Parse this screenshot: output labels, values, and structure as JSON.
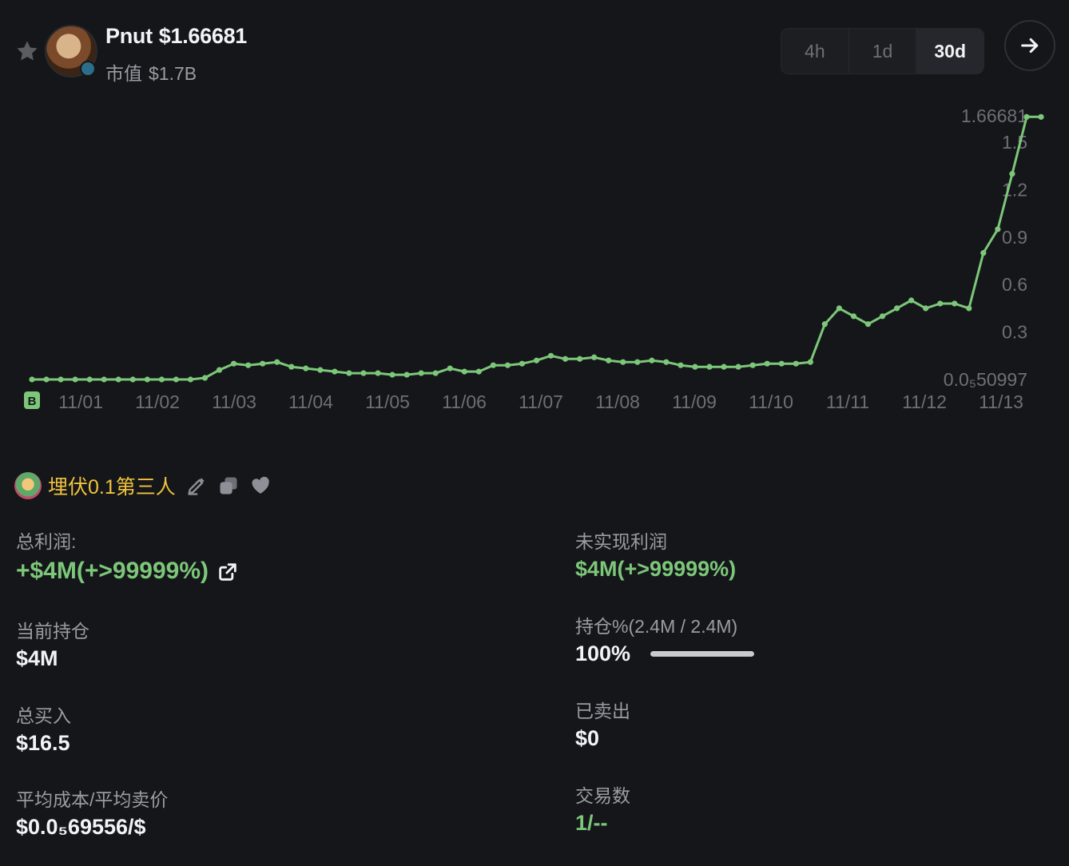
{
  "header": {
    "token_name": "Pnut",
    "price": "$1.66681",
    "market_cap_label": "市值",
    "market_cap_value": "$1.7B"
  },
  "timeframes": [
    {
      "label": "4h",
      "active": false
    },
    {
      "label": "1d",
      "active": false
    },
    {
      "label": "30d",
      "active": true
    }
  ],
  "chart_data": {
    "type": "line",
    "x": [
      "11/01",
      "11/02",
      "11/03",
      "11/04",
      "11/05",
      "11/06",
      "11/07",
      "11/08",
      "11/09",
      "11/10",
      "11/11",
      "11/12",
      "11/13"
    ],
    "y_tick_labels": [
      "1.66681",
      "1.5",
      "1.2",
      "0.9",
      "0.6",
      "0.3",
      "0.0₅50997"
    ],
    "ylim": [
      0,
      1.66681
    ],
    "start_marker": "B",
    "series_values": [
      0,
      0,
      0,
      0,
      0,
      0,
      0,
      0,
      0,
      0,
      0,
      0,
      0.01,
      0.06,
      0.1,
      0.09,
      0.1,
      0.11,
      0.08,
      0.07,
      0.06,
      0.05,
      0.04,
      0.04,
      0.04,
      0.03,
      0.03,
      0.04,
      0.04,
      0.07,
      0.05,
      0.05,
      0.09,
      0.09,
      0.1,
      0.12,
      0.15,
      0.13,
      0.13,
      0.14,
      0.12,
      0.11,
      0.11,
      0.12,
      0.11,
      0.09,
      0.08,
      0.08,
      0.08,
      0.08,
      0.09,
      0.1,
      0.1,
      0.1,
      0.11,
      0.35,
      0.45,
      0.4,
      0.35,
      0.4,
      0.45,
      0.5,
      0.45,
      0.48,
      0.48,
      0.45,
      0.8,
      0.95,
      1.3,
      1.66,
      1.66
    ],
    "color": "#7cc779"
  },
  "profile": {
    "name": "埋伏0.1第三人"
  },
  "stats": {
    "total_pnl_label": "总利润:",
    "total_pnl_value": "+$4M(+>99999%)",
    "unrealized_label": "未实现利润",
    "unrealized_value": "$4M(+>99999%)",
    "holding_label": "当前持仓",
    "holding_value": "$4M",
    "holding_pct_label": "持仓%(2.4M / 2.4M)",
    "holding_pct_value": "100%",
    "holding_pct_fraction": 1.0,
    "total_buy_label": "总买入",
    "total_buy_value": "$16.5",
    "sold_label": "已卖出",
    "sold_value": "$0",
    "avg_label": "平均成本/平均卖价",
    "avg_value": "$0.0₅69556/$",
    "tx_label": "交易数",
    "tx_value": "1/--"
  }
}
